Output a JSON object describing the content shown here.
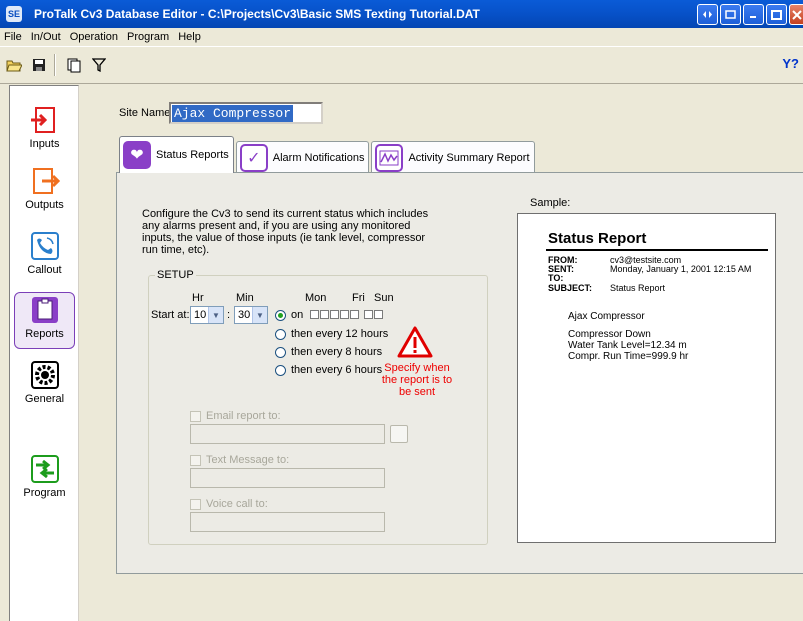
{
  "window": {
    "title": "ProTalk Cv3 Database Editor - C:\\Projects\\Cv3\\Basic SMS Texting Tutorial.DAT",
    "app_icon": "SE",
    "buttons": [
      "restore-icon",
      "app-icon",
      "minimize-icon",
      "maximize-icon",
      "close-icon"
    ]
  },
  "menu": [
    "File",
    "In/Out",
    "Operation",
    "Program",
    "Help"
  ],
  "toolbar": {
    "icons": [
      "open-folder-icon",
      "save-icon",
      "copy-icon",
      "filter-icon"
    ],
    "help_filter": "Y?"
  },
  "sidebar": [
    {
      "label": "Inputs",
      "icon": "inputs-icon",
      "color": "#e02020"
    },
    {
      "label": "Outputs",
      "icon": "outputs-icon",
      "color": "#f07020"
    },
    {
      "label": "Callout",
      "icon": "callout-icon",
      "color": "#2a7fcc"
    },
    {
      "label": "Reports",
      "icon": "reports-icon",
      "color": "#8a3fc7"
    },
    {
      "label": "General",
      "icon": "gears-icon",
      "color": "#000000"
    },
    {
      "label": "Program",
      "icon": "program-icon",
      "color": "#1c9c1c"
    }
  ],
  "site": {
    "label": "Site Name:",
    "value": "Ajax Compressor"
  },
  "tabs": [
    {
      "label": "Status Reports",
      "active": true
    },
    {
      "label": "Alarm Notifications",
      "active": false
    },
    {
      "label": "Activity Summary Report",
      "active": false
    }
  ],
  "description": "Configure the Cv3 to send its current status which includes any alarms present and, if you are using any monitored inputs, the value of those inputs (ie tank level,  compressor run time, etc).",
  "setup": {
    "legend": "SETUP",
    "hr_label": "Hr",
    "min_label": "Min",
    "start_label": "Start at:",
    "hour": "10",
    "minute": "30",
    "colon": ":",
    "days": {
      "mon": "Mon",
      "fri": "Fri",
      "sun": "Sun"
    },
    "options": [
      {
        "label": "on",
        "selected": true
      },
      {
        "label": "then every 12 hours",
        "selected": false
      },
      {
        "label": "then every 8 hours",
        "selected": false
      },
      {
        "label": "then every 6 hours",
        "selected": false
      }
    ],
    "warning": "Specify when the report is to be sent",
    "email_label": "Email report to:",
    "text_label": "Text Message to:",
    "voice_label": "Voice call to:"
  },
  "sample": {
    "label": "Sample:",
    "title": "Status Report",
    "fields": [
      {
        "key": "FROM:",
        "value": "cv3@testsite.com"
      },
      {
        "key": "SENT:",
        "value": "Monday, January 1, 2001  12:15 AM"
      },
      {
        "key": "TO:",
        "value": ""
      },
      {
        "key": "SUBJECT:",
        "value": "Status Report"
      }
    ],
    "site": "Ajax Compressor",
    "lines": [
      "Compressor Down",
      "Water Tank Level=12.34 m",
      "Compr. Run Time=999.9 hr"
    ]
  }
}
